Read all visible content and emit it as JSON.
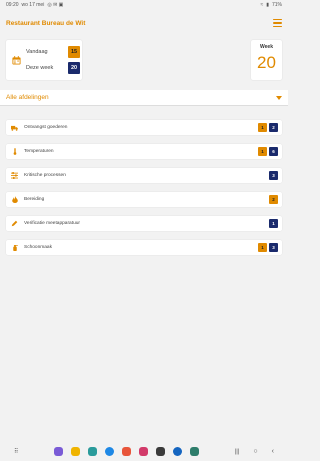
{
  "status_bar": {
    "time": "09:20",
    "date": "wo 17 mei",
    "battery": "71%"
  },
  "header": {
    "title": "Restaurant Bureau de Wit"
  },
  "summary": {
    "today_label": "Vandaag",
    "today_count": "15",
    "week_label": "Deze week",
    "week_count": "20"
  },
  "week_card": {
    "label": "Week",
    "number": "20"
  },
  "section": {
    "title": "Alle afdelingen"
  },
  "items": [
    {
      "label": "Ontvangst goederen",
      "icon": "truck-icon",
      "orange": "1",
      "navy": "2"
    },
    {
      "label": "Temperaturen",
      "icon": "thermometer-icon",
      "orange": "1",
      "navy": "6"
    },
    {
      "label": "Kritische processen",
      "icon": "sliders-icon",
      "orange": "",
      "navy": "3"
    },
    {
      "label": "Bereiding",
      "icon": "flame-icon",
      "orange": "2",
      "navy": ""
    },
    {
      "label": "Verificatie meetapparatuur",
      "icon": "pencil-icon",
      "orange": "",
      "navy": "1"
    },
    {
      "label": "Schoonmaak",
      "icon": "spray-bottle-icon",
      "orange": "1",
      "navy": "3"
    }
  ],
  "colors": {
    "accent": "#e08a00",
    "navy": "#1a2a6c"
  }
}
